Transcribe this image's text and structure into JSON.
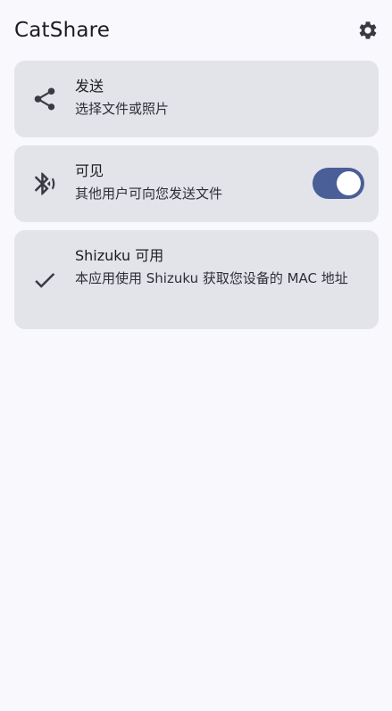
{
  "app_bar": {
    "title": "CatShare",
    "settings_icon": "gear-icon"
  },
  "cards": {
    "send": {
      "icon": "share-icon",
      "title": "发送",
      "subtitle": "选择文件或照片"
    },
    "visible": {
      "icon": "bluetooth-searching-icon",
      "title": "可见",
      "subtitle": "其他用户可向您发送文件",
      "toggle_on": true
    },
    "shizuku": {
      "icon": "check-icon",
      "title": "Shizuku 可用",
      "subtitle": "本应用使用 Shizuku 获取您设备的 MAC 地址"
    }
  },
  "colors": {
    "background": "#f8f8fd",
    "card": "#e3e3ea",
    "accent": "#4a5e97"
  }
}
